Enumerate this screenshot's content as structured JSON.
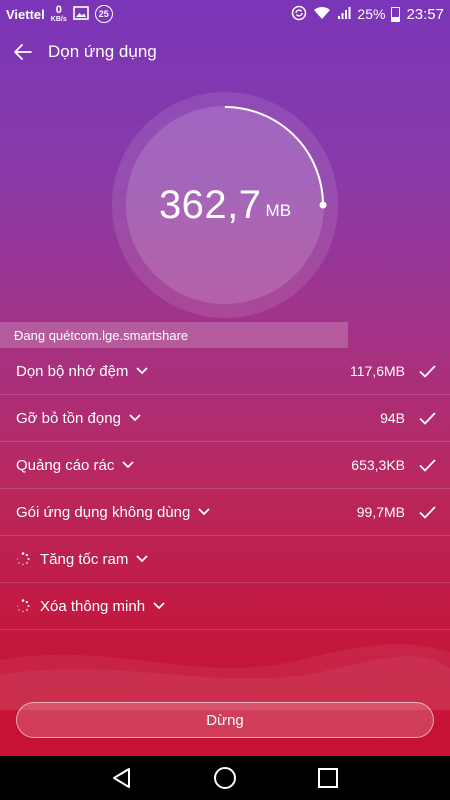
{
  "status_bar": {
    "carrier": "Viettel",
    "net_speed": "0",
    "net_unit": "KB/s",
    "notification_count": "25",
    "battery": "25%",
    "time": "23:57",
    "icons": [
      "image-icon",
      "sync-icon",
      "wifi-icon",
      "signal-icon",
      "battery-icon"
    ]
  },
  "header": {
    "title": "Dọn ứng dụng",
    "back_icon": "arrow-left-icon"
  },
  "scan": {
    "size_value": "362,7",
    "size_unit": "MB",
    "progress": 0.25,
    "scanning_text": "Đang quétcom.lge.smartshare"
  },
  "items": [
    {
      "label": "Dọn bộ nhớ đệm",
      "value": "117,6MB",
      "status": "done"
    },
    {
      "label": "Gỡ bỏ tồn đọng",
      "value": "94B",
      "status": "done"
    },
    {
      "label": "Quảng cáo rác",
      "value": "653,3KB",
      "status": "done"
    },
    {
      "label": "Gói ứng dụng không dùng",
      "value": "99,7MB",
      "status": "done"
    },
    {
      "label": "Tăng tốc ram",
      "value": "",
      "status": "loading"
    },
    {
      "label": "Xóa thông minh",
      "value": "",
      "status": "loading"
    }
  ],
  "stop_button": {
    "label": "Dừng"
  },
  "nav": {
    "back_icon": "triangle-back-icon",
    "home_icon": "circle-home-icon",
    "recents_icon": "square-recents-icon"
  },
  "colors": {
    "gradient_top": "#7a35b8",
    "gradient_bottom": "#c8102e",
    "nav_background": "#000000"
  }
}
